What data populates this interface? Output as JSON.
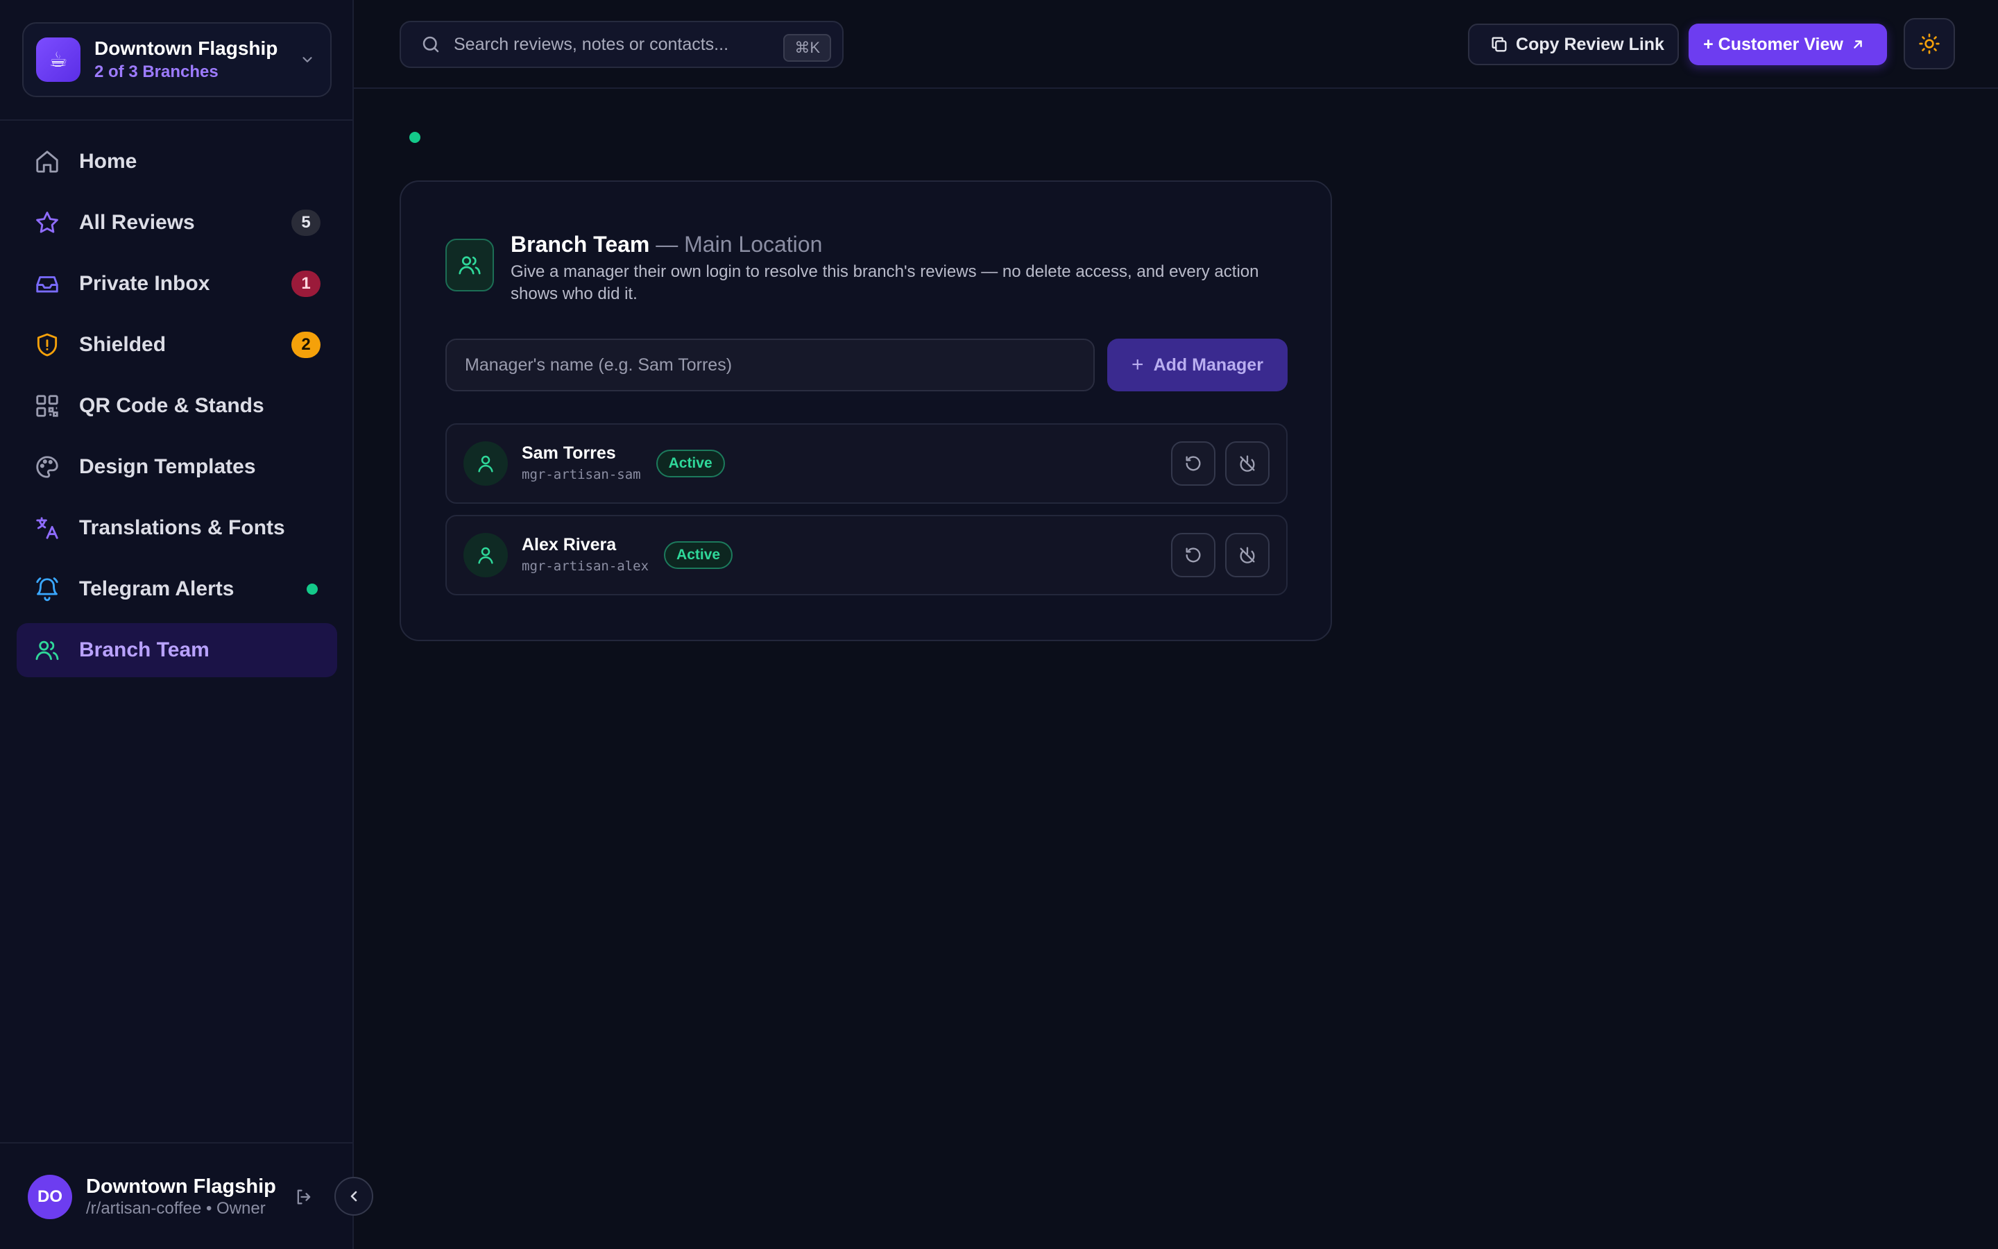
{
  "sidebar": {
    "branch": {
      "title": "Downtown Flagship",
      "subtitle": "2 of 3 Branches",
      "logo": "☕"
    },
    "items": [
      {
        "label": "Home",
        "icon": "home-icon"
      },
      {
        "label": "All Reviews",
        "icon": "star-icon",
        "badge": "5"
      },
      {
        "label": "Private Inbox",
        "icon": "inbox-icon",
        "badge": "1"
      },
      {
        "label": "Shielded",
        "icon": "shield-icon",
        "badge": "2"
      },
      {
        "label": "QR Code & Stands",
        "icon": "qr-code-icon"
      },
      {
        "label": "Design Templates",
        "icon": "palette-icon"
      },
      {
        "label": "Translations & Fonts",
        "icon": "translate-icon"
      },
      {
        "label": "Telegram Alerts",
        "icon": "bell-icon"
      },
      {
        "label": "Branch Team",
        "icon": "users-icon",
        "active": true
      }
    ],
    "account": {
      "initials": "DO",
      "name": "Downtown Flagship",
      "subtitle": "/r/artisan-coffee • Owner"
    }
  },
  "topbar": {
    "search_placeholder": "Search reviews, notes or contacts...",
    "search_shortcut": "⌘K",
    "copy_link_label": "Copy Review Link",
    "customer_view_label": "+ Customer View"
  },
  "card": {
    "title": "Branch Team",
    "title_suffix": " — Main Location",
    "description": "Give a manager their own login to resolve this branch's reviews — no delete access, and every action shows who did it.",
    "input_placeholder": "Manager's name (e.g. Sam Torres)",
    "add_label": "Add Manager",
    "members": [
      {
        "name": "Sam Torres",
        "handle": "mgr-artisan-sam",
        "status": "Active"
      },
      {
        "name": "Alex Rivera",
        "handle": "mgr-artisan-alex",
        "status": "Active"
      }
    ]
  },
  "colors": {
    "accent": "#6d3df0",
    "success": "#14c98a",
    "warning": "#f5a10a",
    "danger": "#9b1a3a",
    "background": "#0b0e1a"
  }
}
